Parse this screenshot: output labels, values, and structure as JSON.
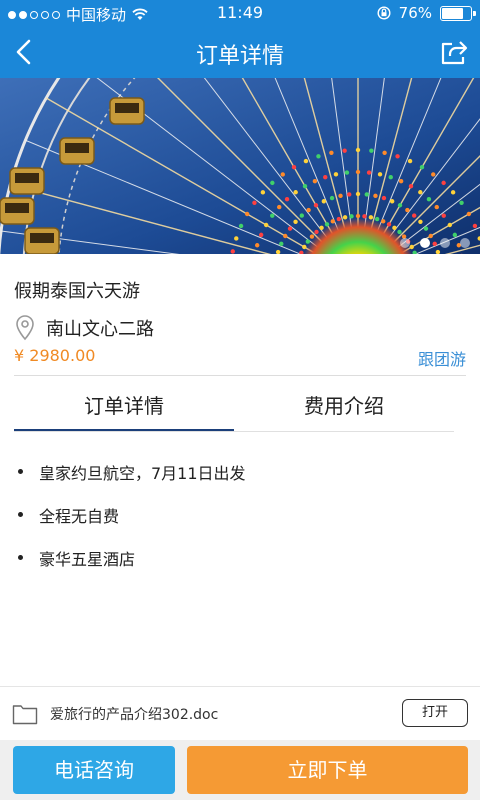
{
  "status_bar": {
    "carrier": "中国移动",
    "time": "11:49",
    "battery_percent": "76%",
    "battery_level": 0.76,
    "signal_bars_filled": 2,
    "signal_bars_total": 5
  },
  "navbar": {
    "title": "订单详情",
    "back_icon": "chevron-left-icon",
    "share_icon": "share-icon",
    "color": "#1b87d8"
  },
  "banner": {
    "description_icon": "ferris-wheel-photo",
    "pages": 4,
    "active_page": 1
  },
  "product": {
    "title": "假期泰国六天游",
    "address": "南山文心二路",
    "price": "¥ 2980.00",
    "tag_link": "跟团游",
    "price_color": "#f08a24",
    "link_color": "#3a8fd6"
  },
  "tabs": [
    {
      "label": "订单详情",
      "active": true
    },
    {
      "label": "费用介绍",
      "active": false
    }
  ],
  "details": [
    "皇家约旦航空，7月11日出发",
    "全程无自费",
    "豪华五星酒店"
  ],
  "attachment": {
    "file_name": "爱旅行的产品介绍302.doc",
    "open_label": "打开",
    "icon": "folder-icon"
  },
  "bottom_bar": {
    "call_label": "电话咨询",
    "order_label": "立即下单",
    "call_color": "#2ea7e6",
    "order_color": "#f59a34"
  }
}
